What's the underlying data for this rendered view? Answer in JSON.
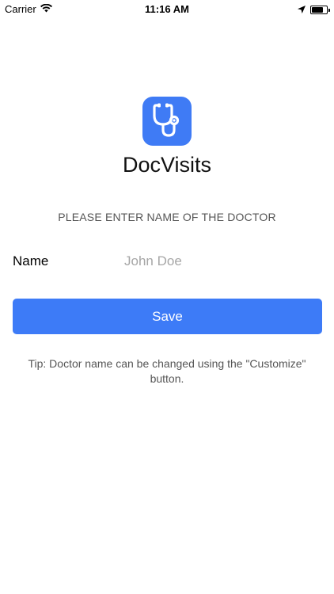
{
  "status_bar": {
    "carrier": "Carrier",
    "time": "11:16 AM",
    "battery_level": 0.8,
    "icons": [
      "wifi-icon",
      "location-arrow-icon",
      "battery-icon"
    ]
  },
  "app": {
    "name": "DocVisits",
    "icon": "stethoscope-icon",
    "accent_color": "#3f7bf5"
  },
  "form": {
    "prompt": "PLEASE ENTER NAME OF THE DOCTOR",
    "name_label": "Name",
    "name_placeholder": "John Doe",
    "name_value": "",
    "save_label": "Save"
  },
  "tip": "Tip: Doctor name can be changed using the \"Customize\" button."
}
